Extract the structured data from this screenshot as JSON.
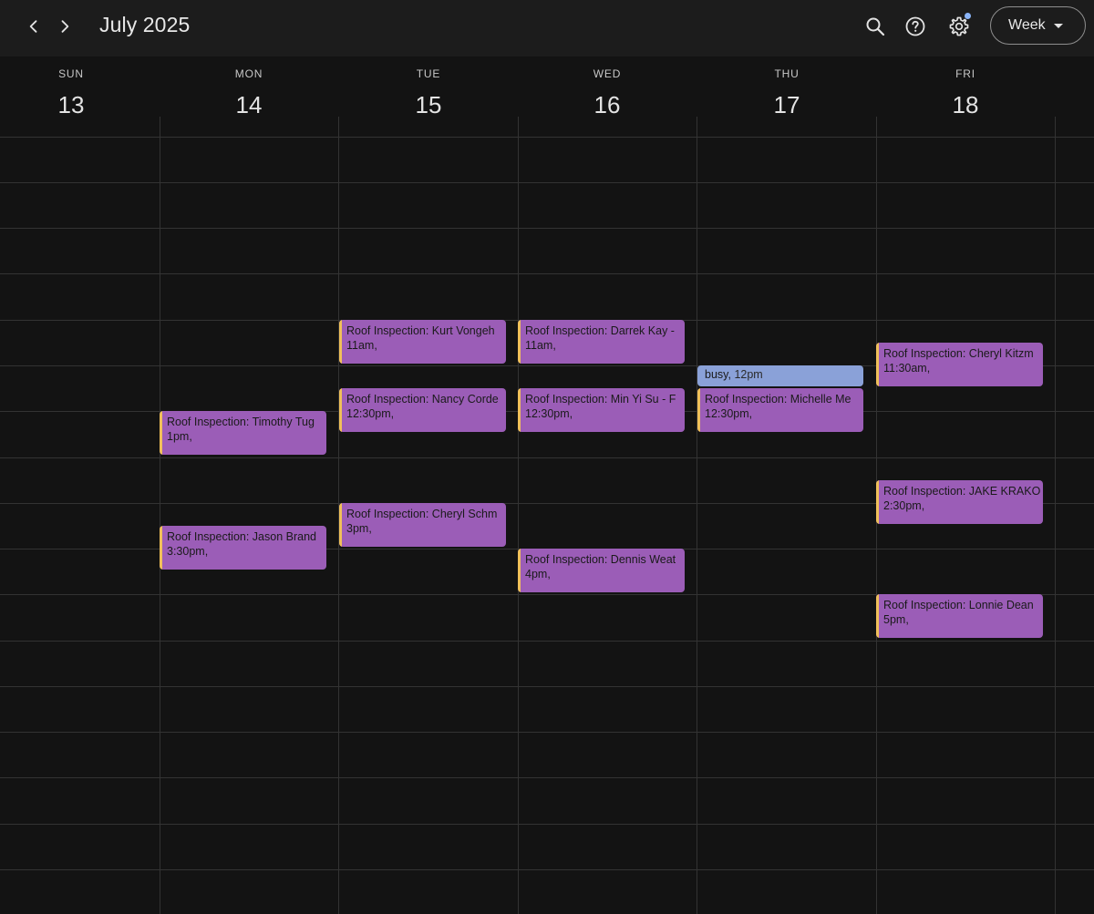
{
  "header": {
    "title": "July 2025",
    "view_label": "Week"
  },
  "days": [
    {
      "name": "SUN",
      "num": "13"
    },
    {
      "name": "MON",
      "num": "14"
    },
    {
      "name": "TUE",
      "num": "15"
    },
    {
      "name": "WED",
      "num": "16"
    },
    {
      "name": "THU",
      "num": "17"
    },
    {
      "name": "FRI",
      "num": "18"
    }
  ],
  "events": {
    "mon_1": {
      "title": "Roof Inspection: Timothy Tug",
      "time": "1pm,"
    },
    "mon_2": {
      "title": "Roof Inspection: Jason Brand",
      "time": "3:30pm,"
    },
    "tue_1": {
      "title": "Roof Inspection: Kurt Vongeh",
      "time": "11am,"
    },
    "tue_2": {
      "title": "Roof Inspection: Nancy Corde",
      "time": "12:30pm,"
    },
    "tue_3": {
      "title": "Roof Inspection: Cheryl Schm",
      "time": "3pm,"
    },
    "wed_1": {
      "title": "Roof Inspection: Darrek Kay -",
      "time": "11am,"
    },
    "wed_2": {
      "title": "Roof Inspection: Min Yi Su - F",
      "time": "12:30pm,"
    },
    "wed_3": {
      "title": "Roof Inspection: Dennis Weat",
      "time": "4pm,"
    },
    "thu_busy": {
      "title": "busy",
      "time": "12pm"
    },
    "thu_1": {
      "title": "Roof Inspection: Michelle Me",
      "time": "12:30pm,"
    },
    "fri_1": {
      "title": "Roof Inspection: Cheryl Kitzm",
      "time": "11:30am,"
    },
    "fri_2": {
      "title": "Roof Inspection: JAKE KRAKO",
      "time": "2:30pm,"
    },
    "fri_3": {
      "title": "Roof Inspection: Lonnie Dean",
      "time": "5pm,"
    }
  },
  "colors": {
    "event_fill": "#9b5db7",
    "event_accent": "#f0c05a",
    "busy_fill": "#8aa1d8",
    "background": "#131313"
  }
}
